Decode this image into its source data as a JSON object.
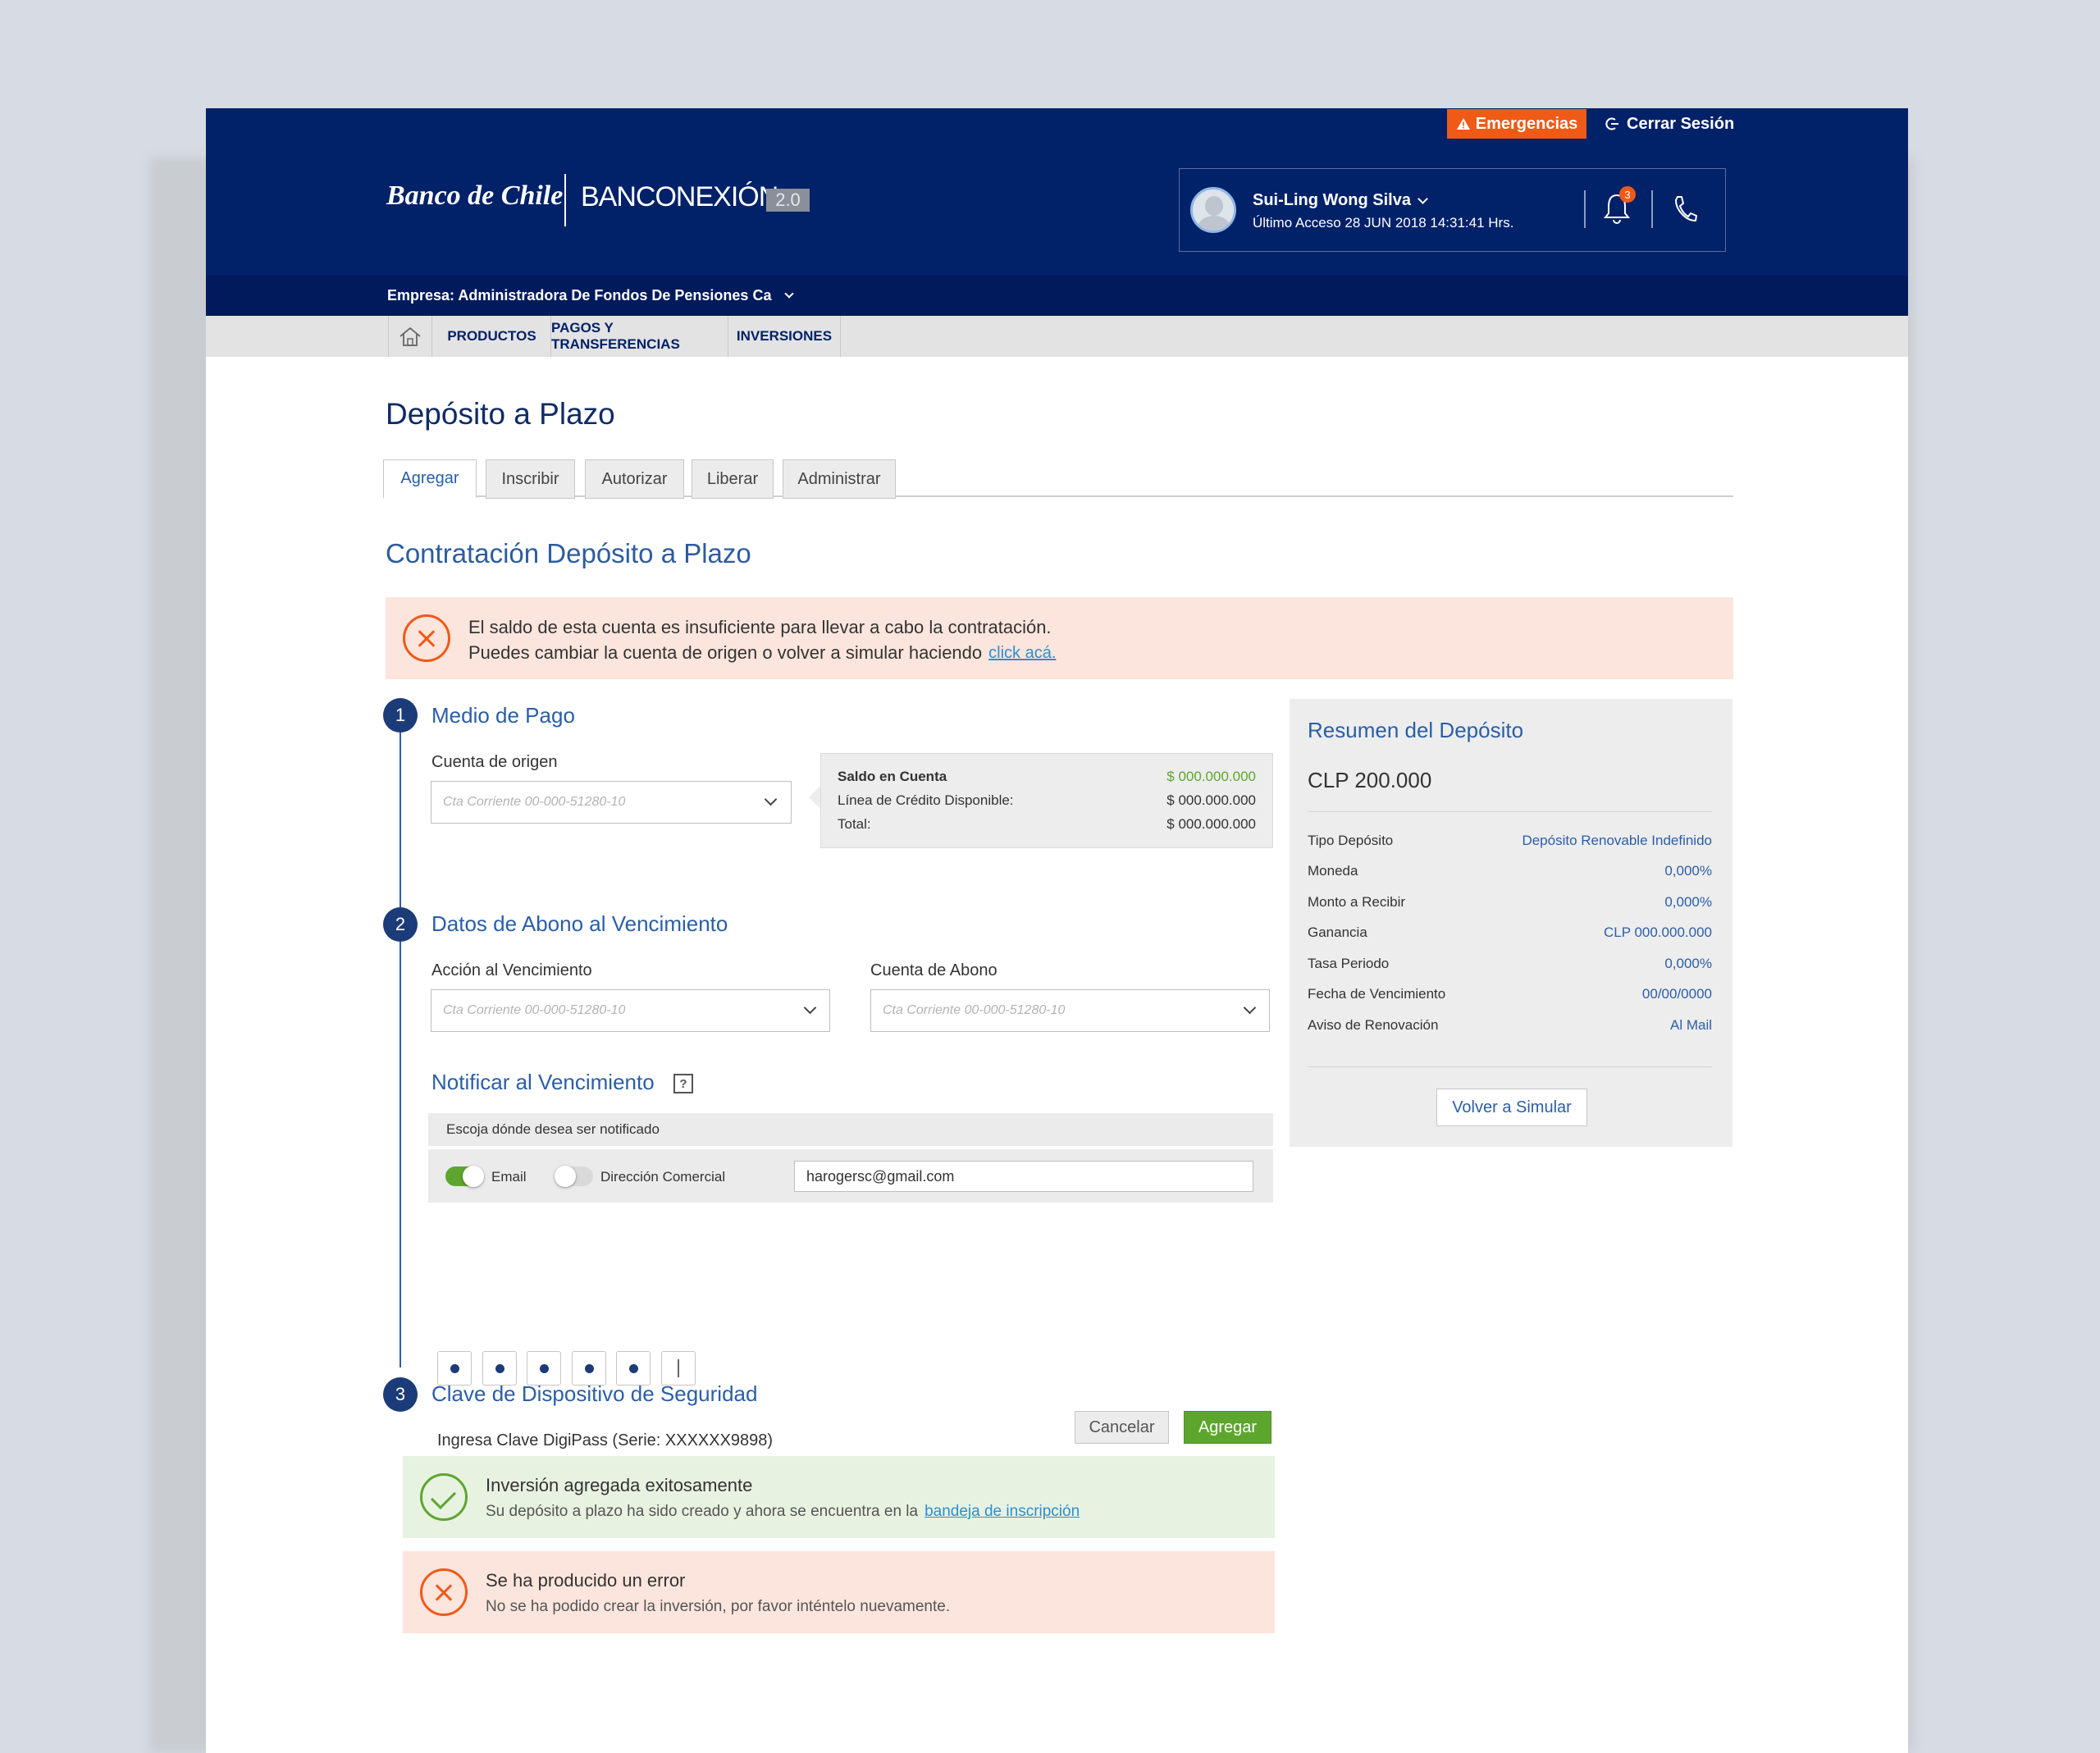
{
  "header": {
    "emergency_label": "Emergencias",
    "logout_label": "Cerrar Sesión",
    "bank_name": "Banco de Chile",
    "product_name": "BANCONEXIÓN",
    "product_version": "2.0",
    "user_name": "Sui-Ling Wong Silva",
    "last_access": "Último Acceso 28 JUN 2018 14:31:41 Hrs.",
    "notification_count": "3",
    "company": "Empresa: Administradora De Fondos De Pensiones Ca"
  },
  "nav": {
    "items": [
      "PRODUCTOS",
      "PAGOS Y TRANSFERENCIAS",
      "INVERSIONES"
    ]
  },
  "page": {
    "title": "Depósito a Plazo",
    "tabs": [
      "Agregar",
      "Inscribir",
      "Autorizar",
      "Liberar",
      "Administrar"
    ],
    "active_tab": "Agregar",
    "section_title": "Contratación Depósito a Plazo"
  },
  "top_alert": {
    "line1": "El saldo de esta cuenta es insuficiente para llevar a cabo la contratación.",
    "line2": "Puedes cambiar la cuenta de origen o volver a simular haciendo",
    "link": "click acá."
  },
  "step1": {
    "number": "1",
    "title": "Medio de Pago",
    "account_label": "Cuenta de origen",
    "account_placeholder": "Cta Corriente 00-000-51280-10",
    "balance": {
      "rows": [
        {
          "label": "Saldo en Cuenta",
          "value": "$ 000.000.000"
        },
        {
          "label": "Línea de Crédito Disponible:",
          "value": "$ 000.000.000"
        },
        {
          "label": "Total:",
          "value": "$ 000.000.000"
        }
      ]
    }
  },
  "step2": {
    "number": "2",
    "title": "Datos de Abono al Vencimiento",
    "action_label": "Acción al Vencimiento",
    "action_placeholder": "Cta Corriente 00-000-51280-10",
    "credit_account_label": "Cuenta de Abono",
    "credit_account_placeholder": "Cta Corriente 00-000-51280-10",
    "notify_title": "Notificar al Vencimiento",
    "notify_help": "?",
    "notify_prompt": "Escoja dónde desea ser notificado",
    "email_label": "Email",
    "email_enabled": true,
    "address_label": "Dirección Comercial",
    "address_enabled": false,
    "email_value": "harogersc@gmail.com"
  },
  "step3": {
    "number": "3",
    "title": "Clave de Dispositivo de Seguridad",
    "pin_label": "Ingresa Clave DigiPass (Serie: XXXXXX9898)",
    "pin_filled": 5,
    "pin_length": 6
  },
  "actions": {
    "cancel": "Cancelar",
    "add": "Agregar"
  },
  "success_alert": {
    "title": "Inversión agregada exitosamente",
    "text": "Su depósito a plazo ha sido creado y ahora se encuentra en la",
    "link": "bandeja de inscripción"
  },
  "error_alert": {
    "title": "Se ha producido un error",
    "text": "No se ha podido crear la inversión, por favor inténtelo nuevamente."
  },
  "summary": {
    "title": "Resumen del Depósito",
    "amount": "CLP 200.000",
    "rows": [
      {
        "label": "Tipo Depósito",
        "value": "Depósito Renovable Indefinido"
      },
      {
        "label": "Moneda",
        "value": "0,000%"
      },
      {
        "label": "Monto a Recibir",
        "value": "0,000%"
      },
      {
        "label": "Ganancia",
        "value": "CLP 000.000.000"
      },
      {
        "label": "Tasa Periodo",
        "value": "0,000%"
      },
      {
        "label": "Fecha de Vencimiento",
        "value": "00/00/0000"
      },
      {
        "label": "Aviso de Renovación",
        "value": "Al Mail"
      }
    ],
    "button": "Volver a Simular"
  },
  "colors": {
    "header_bg": "#012169",
    "accent_blue": "#2a5ea8",
    "emergency": "#f05a17",
    "success_green": "#5da62e",
    "error_bg": "#fce5dc",
    "success_bg": "#e8f2e1"
  }
}
